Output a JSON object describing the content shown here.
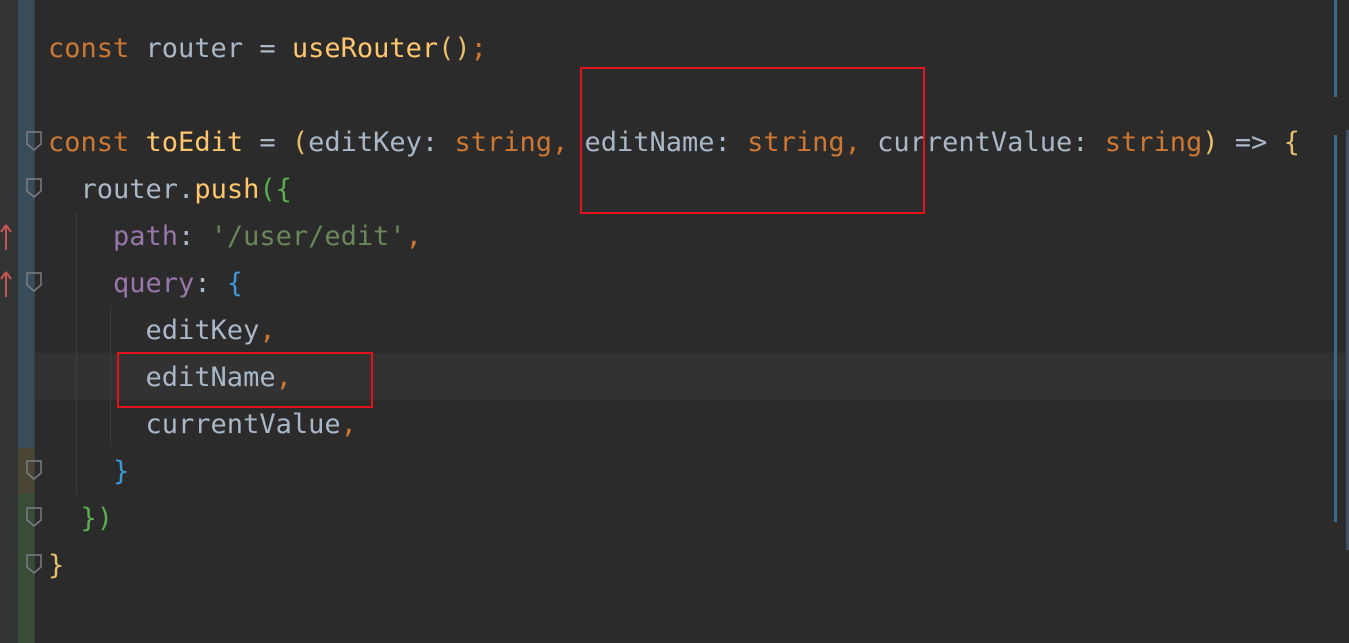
{
  "editor": {
    "lines": [
      [
        {
          "t": "const",
          "c": "kw"
        },
        {
          "t": " router = ",
          "c": "id"
        },
        {
          "t": "useRouter",
          "c": "fn"
        },
        {
          "t": "()",
          "c": "p1"
        },
        {
          "t": ";",
          "c": "kw"
        }
      ],
      [],
      [
        {
          "t": "const",
          "c": "kw"
        },
        {
          "t": " ",
          "c": "id"
        },
        {
          "t": "toEdit",
          "c": "fn"
        },
        {
          "t": " = ",
          "c": "id"
        },
        {
          "t": "(",
          "c": "p1"
        },
        {
          "t": "editKey: ",
          "c": "id"
        },
        {
          "t": "string",
          "c": "type"
        },
        {
          "t": ", ",
          "c": "kw"
        },
        {
          "t": "editName: ",
          "c": "id"
        },
        {
          "t": "string",
          "c": "type"
        },
        {
          "t": ", ",
          "c": "kw"
        },
        {
          "t": "currentValue: ",
          "c": "id"
        },
        {
          "t": "string",
          "c": "type"
        },
        {
          "t": ")",
          "c": "p1"
        },
        {
          "t": " => ",
          "c": "id"
        },
        {
          "t": "{",
          "c": "p1"
        }
      ],
      [
        {
          "t": "  router.",
          "c": "id"
        },
        {
          "t": "push",
          "c": "fn"
        },
        {
          "t": "(",
          "c": "p2"
        },
        {
          "t": "{",
          "c": "p2"
        }
      ],
      [
        {
          "t": "    ",
          "c": "id"
        },
        {
          "t": "path",
          "c": "prop"
        },
        {
          "t": ": ",
          "c": "id"
        },
        {
          "t": "'/user/edit'",
          "c": "str"
        },
        {
          "t": ",",
          "c": "kw"
        }
      ],
      [
        {
          "t": "    ",
          "c": "id"
        },
        {
          "t": "query",
          "c": "prop"
        },
        {
          "t": ": ",
          "c": "id"
        },
        {
          "t": "{",
          "c": "p3"
        }
      ],
      [
        {
          "t": "      editKey",
          "c": "id"
        },
        {
          "t": ",",
          "c": "kw"
        }
      ],
      [
        {
          "t": "      editName",
          "c": "id"
        },
        {
          "t": ",",
          "c": "kw"
        }
      ],
      [
        {
          "t": "      currentValue",
          "c": "id"
        },
        {
          "t": ",",
          "c": "kw"
        }
      ],
      [
        {
          "t": "    ",
          "c": "id"
        },
        {
          "t": "}",
          "c": "p3"
        }
      ],
      [
        {
          "t": "  ",
          "c": "id"
        },
        {
          "t": "}",
          "c": "p2"
        },
        {
          "t": ")",
          "c": "p2"
        }
      ],
      [
        {
          "t": "}",
          "c": "p1"
        }
      ]
    ],
    "fold_markers": [
      2,
      3,
      5,
      9,
      10,
      11
    ],
    "change_arrow_lines": [
      4,
      5
    ],
    "current_line": 7,
    "colors": {
      "background": "#2b2b2b",
      "keyword": "#cc7832",
      "function": "#ffc66d",
      "property": "#9876aa",
      "string": "#6a8759",
      "text": "#a9b7c6",
      "highlight_box": "#e0141a"
    }
  },
  "icons": {
    "fold": "fold-icon",
    "change": "change-arrow-icon"
  }
}
